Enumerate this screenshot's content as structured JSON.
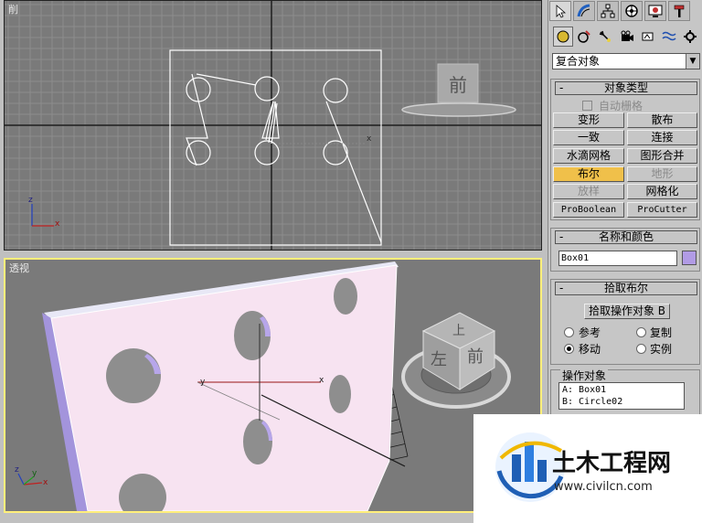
{
  "viewports": {
    "front": {
      "label": "削"
    },
    "perspective": {
      "label": "透视"
    },
    "viewcube_front": {
      "label": "前"
    },
    "viewcube_persp": {
      "top": "上",
      "left": "左",
      "front": "前"
    },
    "axes": {
      "x": "x",
      "y": "y",
      "z": "z"
    }
  },
  "command_panel": {
    "tabs": [
      {
        "icon": "arrow-pointer-icon",
        "label": "create"
      },
      {
        "icon": "bend-icon",
        "label": "modify"
      },
      {
        "icon": "hierarchy-icon",
        "label": "hierarchy"
      },
      {
        "icon": "wheel-icon",
        "label": "motion"
      },
      {
        "icon": "monitor-icon",
        "label": "display"
      },
      {
        "icon": "hammer-icon",
        "label": "utilities"
      }
    ],
    "categories": [
      {
        "icon": "sphere-icon"
      },
      {
        "icon": "shape-icon"
      },
      {
        "icon": "light-icon"
      },
      {
        "icon": "camera-icon"
      },
      {
        "icon": "helper-icon"
      },
      {
        "icon": "spacewarp-icon"
      },
      {
        "icon": "system-icon"
      }
    ],
    "dropdown_value": "复合对象",
    "object_type": {
      "title": "对象类型",
      "auto_grid": "自动栅格",
      "buttons": [
        {
          "label": "变形",
          "state": "normal"
        },
        {
          "label": "散布",
          "state": "normal"
        },
        {
          "label": "一致",
          "state": "normal"
        },
        {
          "label": "连接",
          "state": "normal"
        },
        {
          "label": "水滴网格",
          "state": "normal"
        },
        {
          "label": "图形合并",
          "state": "normal"
        },
        {
          "label": "布尔",
          "state": "on"
        },
        {
          "label": "地形",
          "state": "disabled"
        },
        {
          "label": "放样",
          "state": "disabled"
        },
        {
          "label": "网格化",
          "state": "normal"
        },
        {
          "label": "ProBoolean",
          "state": "normal"
        },
        {
          "label": "ProCutter",
          "state": "normal"
        }
      ]
    },
    "name_color": {
      "title": "名称和颜色",
      "name_value": "Box01",
      "swatch_color": "#b19be5"
    },
    "pick_boolean": {
      "title": "拾取布尔",
      "pick_button": "拾取操作对象 B",
      "options": [
        {
          "label": "参考",
          "selected": false
        },
        {
          "label": "复制",
          "selected": false
        },
        {
          "label": "移动",
          "selected": true
        },
        {
          "label": "实例",
          "selected": false
        }
      ]
    },
    "operands": {
      "title": "操作对象",
      "items": [
        "A: Box01",
        "B: Circle02"
      ]
    }
  },
  "watermark": {
    "brand": "土木工程网",
    "url": "www.civilcn.com"
  },
  "colors": {
    "viewport_bg": "#7a7a7a",
    "active_viewport_border": "#ffef7a",
    "boolean_active": "#f0c04a",
    "panel_bg": "#c6c6c6"
  }
}
